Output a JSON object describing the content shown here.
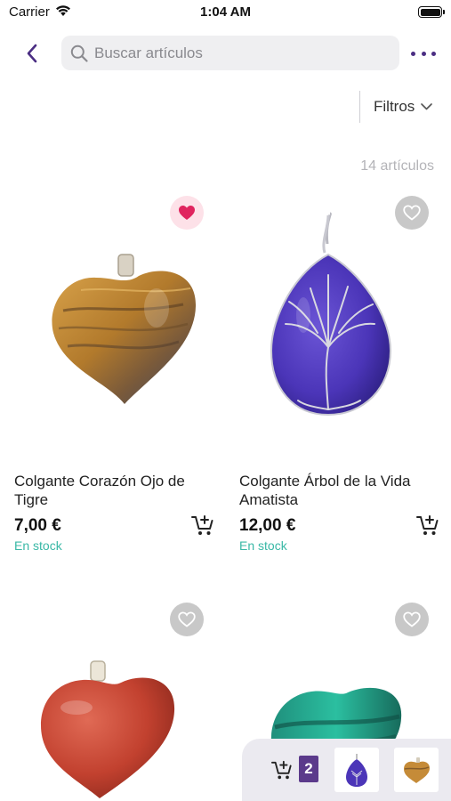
{
  "status": {
    "carrier": "Carrier",
    "time": "1:04 AM"
  },
  "nav": {
    "search_placeholder": "Buscar artículos"
  },
  "filters": {
    "label": "Filtros"
  },
  "results": {
    "count_text": "14 artículos"
  },
  "products": [
    {
      "title": "Colgante Corazón Ojo de Tigre",
      "price": "7,00 €",
      "stock": "En stock",
      "favorite": true
    },
    {
      "title": "Colgante Árbol de la Vida Amatista",
      "price": "12,00 €",
      "stock": "En stock",
      "favorite": false
    },
    {
      "title": "",
      "price": "",
      "stock": "",
      "favorite": false
    },
    {
      "title": "",
      "price": "",
      "stock": "",
      "favorite": false
    }
  ],
  "basket": {
    "count": "2"
  },
  "colors": {
    "accent": "#4b2e83",
    "stock": "#39b8a6",
    "favorite": "#e0245e"
  },
  "icons": [
    "back-chevron-icon",
    "search-icon",
    "more-dots-icon",
    "chevron-down-icon",
    "heart-icon",
    "add-to-cart-icon"
  ]
}
